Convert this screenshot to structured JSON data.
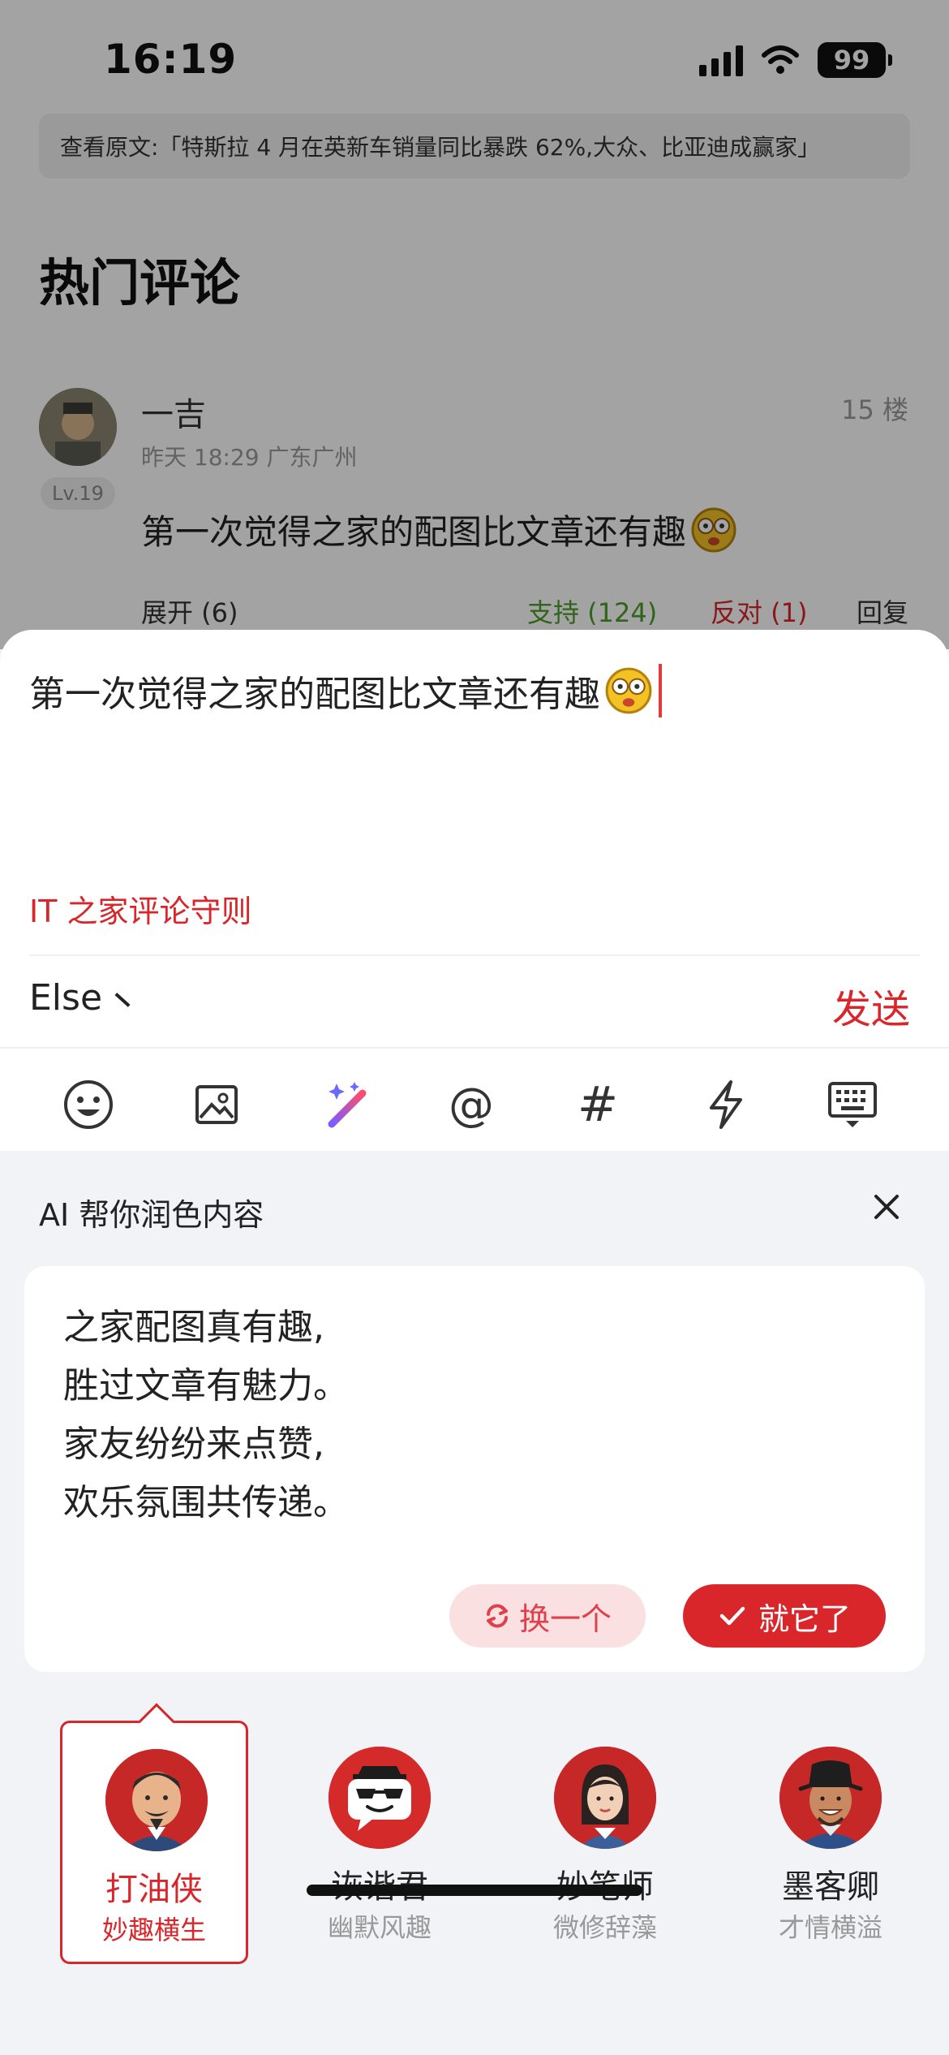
{
  "status_bar": {
    "time": "16:19",
    "battery": "99",
    "icons": [
      "signal-icon",
      "wifi-icon",
      "battery-icon"
    ]
  },
  "source_banner": "查看原文:「特斯拉 4 月在英新车销量同比暴跌 62%,大众、比亚迪成赢家」",
  "hot_title": "热门评论",
  "comment": {
    "user": "一吉",
    "level": "Lv.19",
    "meta": "昨天 18:29 广东广州",
    "floor": "15 楼",
    "text": "第一次觉得之家的配图比文章还有趣",
    "expand": "展开 (6)",
    "support": "支持 (124)",
    "oppose": "反对 (1)",
    "reply": "回复"
  },
  "composer": {
    "text": "第一次觉得之家的配图比文章还有趣",
    "rules_link": "IT 之家评论守则",
    "account": "Else",
    "send": "发送",
    "tools": [
      "emoji-icon",
      "image-icon",
      "ai-magic-icon",
      "at-icon",
      "hashtag-icon",
      "lightning-icon",
      "keyboard-icon"
    ]
  },
  "ai_panel": {
    "title": "AI 帮你润色内容",
    "lines": [
      "之家配图真有趣,",
      "胜过文章有魅力。",
      "家友纷纷来点赞,",
      "欢乐氛围共传递。"
    ],
    "refresh_label": "换一个",
    "confirm_label": "就它了"
  },
  "styles": [
    {
      "name": "打油侠",
      "subtitle": "妙趣横生",
      "selected": true
    },
    {
      "name": "诙谐君",
      "subtitle": "幽默风趣",
      "selected": false
    },
    {
      "name": "妙笔师",
      "subtitle": "微修辞藻",
      "selected": false
    },
    {
      "name": "墨客卿",
      "subtitle": "才情横溢",
      "selected": false
    }
  ],
  "colors": {
    "accent": "#d8262b",
    "support": "#4e9b2a",
    "sheet_bg": "#f2f3f6"
  }
}
